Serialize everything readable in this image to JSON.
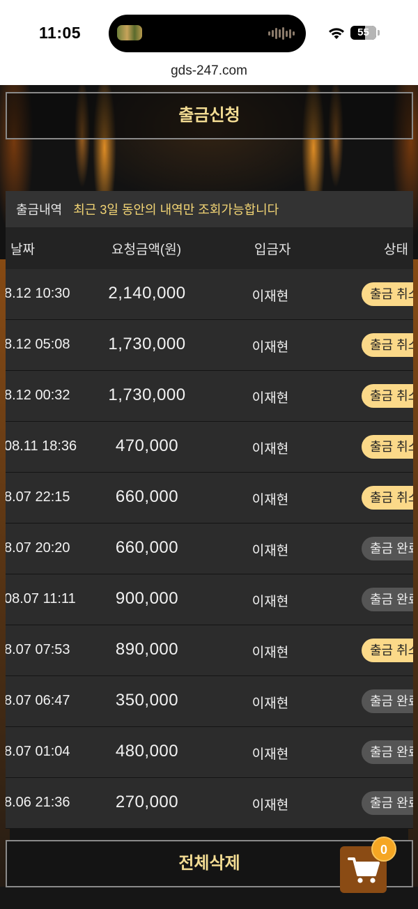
{
  "status_bar": {
    "time": "11:05",
    "battery": "55"
  },
  "browser": {
    "url": "gds-247.com"
  },
  "withdraw_button": "출금신청",
  "history": {
    "title": "출금내역",
    "note": "최근 3일 동안의 내역만 조회가능합니다",
    "columns": {
      "date": "날짜",
      "amount": "요청금액(원)",
      "payer": "입금자",
      "status": "상태"
    },
    "rows": [
      {
        "date": "8.12 10:30",
        "amount": "2,140,000",
        "payer": "이재현",
        "status": "출금 취소",
        "type": "cancel"
      },
      {
        "date": "8.12 05:08",
        "amount": "1,730,000",
        "payer": "이재현",
        "status": "출금 취소",
        "type": "cancel"
      },
      {
        "date": "8.12 00:32",
        "amount": "1,730,000",
        "payer": "이재현",
        "status": "출금 취소",
        "type": "cancel"
      },
      {
        "date": "08.11 18:36",
        "amount": "470,000",
        "payer": "이재현",
        "status": "출금 취소",
        "type": "cancel"
      },
      {
        "date": "8.07 22:15",
        "amount": "660,000",
        "payer": "이재현",
        "status": "출금 취소",
        "type": "cancel"
      },
      {
        "date": "8.07 20:20",
        "amount": "660,000",
        "payer": "이재현",
        "status": "출금 완료",
        "type": "done"
      },
      {
        "date": "08.07 11:11",
        "amount": "900,000",
        "payer": "이재현",
        "status": "출금 완료",
        "type": "done"
      },
      {
        "date": "8.07 07:53",
        "amount": "890,000",
        "payer": "이재현",
        "status": "출금 취소",
        "type": "cancel"
      },
      {
        "date": "8.07 06:47",
        "amount": "350,000",
        "payer": "이재현",
        "status": "출금 완료",
        "type": "done"
      },
      {
        "date": "8.07 01:04",
        "amount": "480,000",
        "payer": "이재현",
        "status": "출금 완료",
        "type": "done"
      },
      {
        "date": "8.06 21:36",
        "amount": "270,000",
        "payer": "이재현",
        "status": "출금 완료",
        "type": "done"
      }
    ]
  },
  "delete_all_button": "전체삭제",
  "cart": {
    "count": "0",
    "icon": "cart-icon"
  },
  "colors": {
    "accent_gold": "#f3dc93",
    "badge_cancel": "#fbd989",
    "badge_done": "#555555",
    "cart_bg": "#8a4b14",
    "cart_badge": "#f5a623"
  }
}
